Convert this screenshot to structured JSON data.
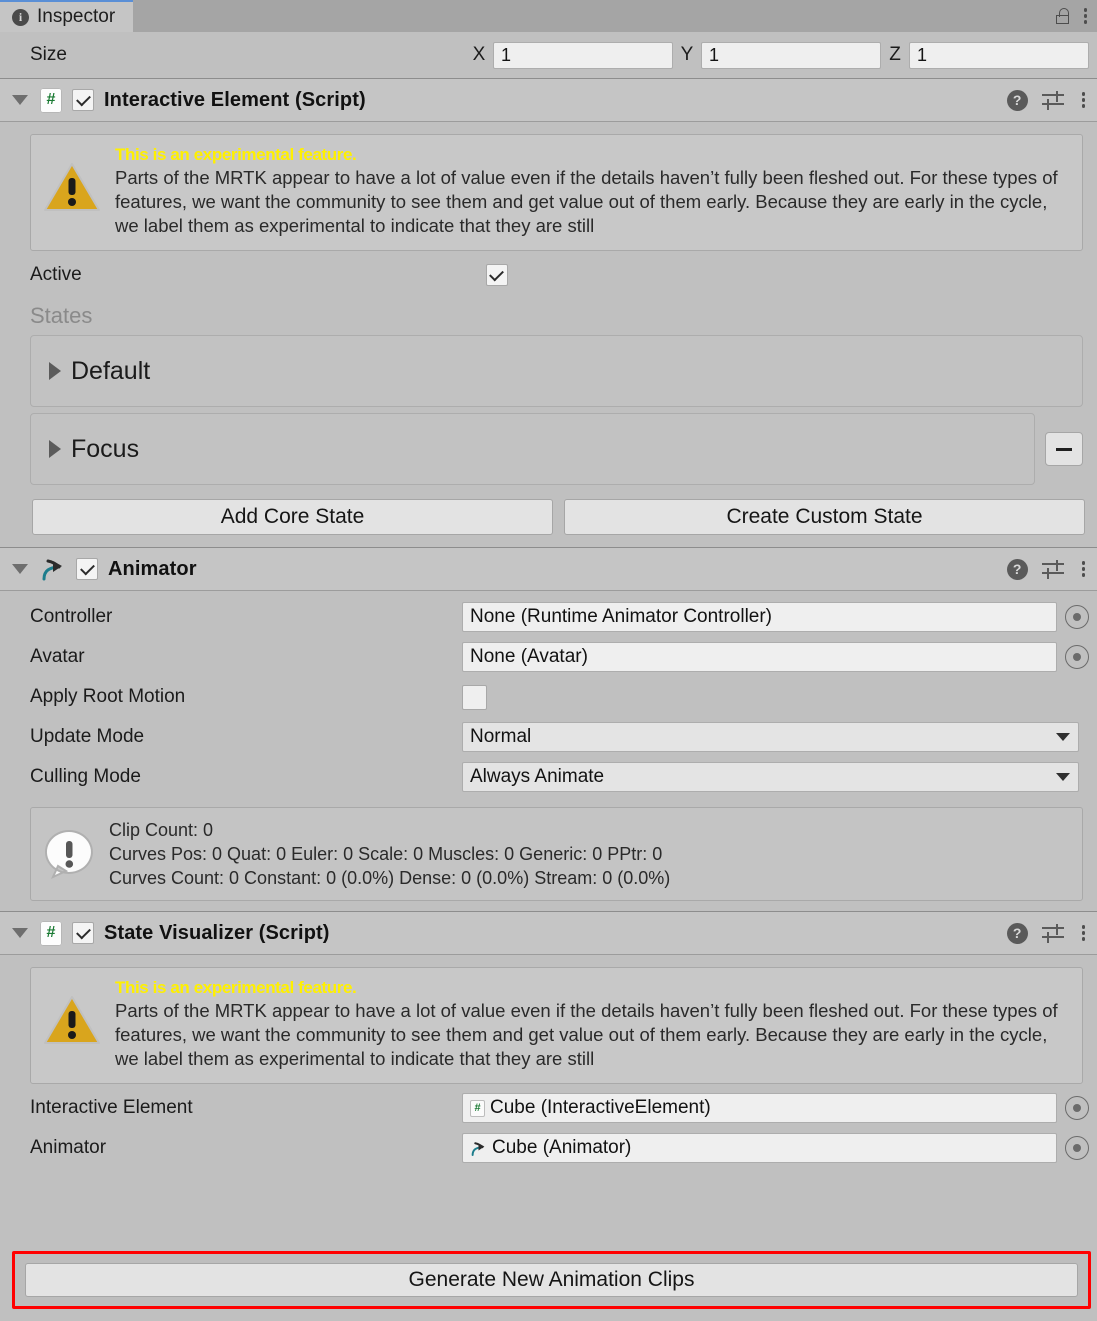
{
  "window": {
    "tab_label": "Inspector",
    "tab_icon": "info-icon",
    "lock_icon": "lock-icon",
    "menu_icon": "kebab-menu-icon"
  },
  "size_row": {
    "label": "Size",
    "axes": [
      {
        "axis": "X",
        "value": "1"
      },
      {
        "axis": "Y",
        "value": "1"
      },
      {
        "axis": "Z",
        "value": "1"
      }
    ]
  },
  "experimental_warning": {
    "title": "This is an experimental feature.",
    "body": "Parts of the MRTK appear to have a lot of value even if the details haven’t fully been fleshed out. For these types of features, we want the community to see them and get value out of them early. Because they are early in the cycle, we label them as experimental to indicate that they are still",
    "icon": "warning-triangle-icon"
  },
  "header_icons": {
    "help": "help-icon",
    "preset": "preset-icon",
    "menu": "kebab-menu-icon"
  },
  "interactive_element": {
    "title": "Interactive Element (Script)",
    "script_icon": "csharp-script-icon",
    "enabled": true,
    "active": {
      "label": "Active",
      "checked": true
    },
    "states_label": "States",
    "states": [
      {
        "name": "Default",
        "removable": false
      },
      {
        "name": "Focus",
        "removable": true
      }
    ],
    "buttons": {
      "add_core_state": "Add Core State",
      "create_custom_state": "Create Custom State"
    }
  },
  "animator": {
    "title": "Animator",
    "icon": "animator-icon",
    "enabled": true,
    "properties": [
      {
        "label": "Controller",
        "value": "None (Runtime Animator Controller)",
        "type": "object"
      },
      {
        "label": "Avatar",
        "value": "None (Avatar)",
        "type": "object"
      },
      {
        "label": "Apply Root Motion",
        "value": "",
        "type": "checkbox",
        "checked": false
      },
      {
        "label": "Update Mode",
        "value": "Normal",
        "type": "dropdown"
      },
      {
        "label": "Culling Mode",
        "value": "Always Animate",
        "type": "dropdown"
      }
    ],
    "info": {
      "icon": "info-bubble-icon",
      "lines": [
        "Clip Count: 0",
        "Curves Pos: 0 Quat: 0 Euler: 0 Scale: 0 Muscles: 0 Generic: 0 PPtr: 0",
        "Curves Count: 0 Constant: 0 (0.0%) Dense: 0 (0.0%) Stream: 0 (0.0%)"
      ]
    }
  },
  "state_visualizer": {
    "title": "State Visualizer (Script)",
    "script_icon": "csharp-script-icon",
    "enabled": true,
    "references": [
      {
        "label": "Interactive Element",
        "value": "Cube (InteractiveElement)",
        "icon": "csharp-script-icon"
      },
      {
        "label": "Animator",
        "value": "Cube (Animator)",
        "icon": "animator-icon"
      }
    ],
    "generate_button": "Generate New Animation Clips"
  },
  "colors": {
    "background": "#c0c0c0",
    "header": "#c5c5c5",
    "field": "#efefef",
    "warning_title": "#fff000",
    "warning_triangle": "#d9a51d",
    "script_green": "#1a7a33",
    "animator_teal": "#1d7d8c",
    "highlight": "#ff0000"
  }
}
